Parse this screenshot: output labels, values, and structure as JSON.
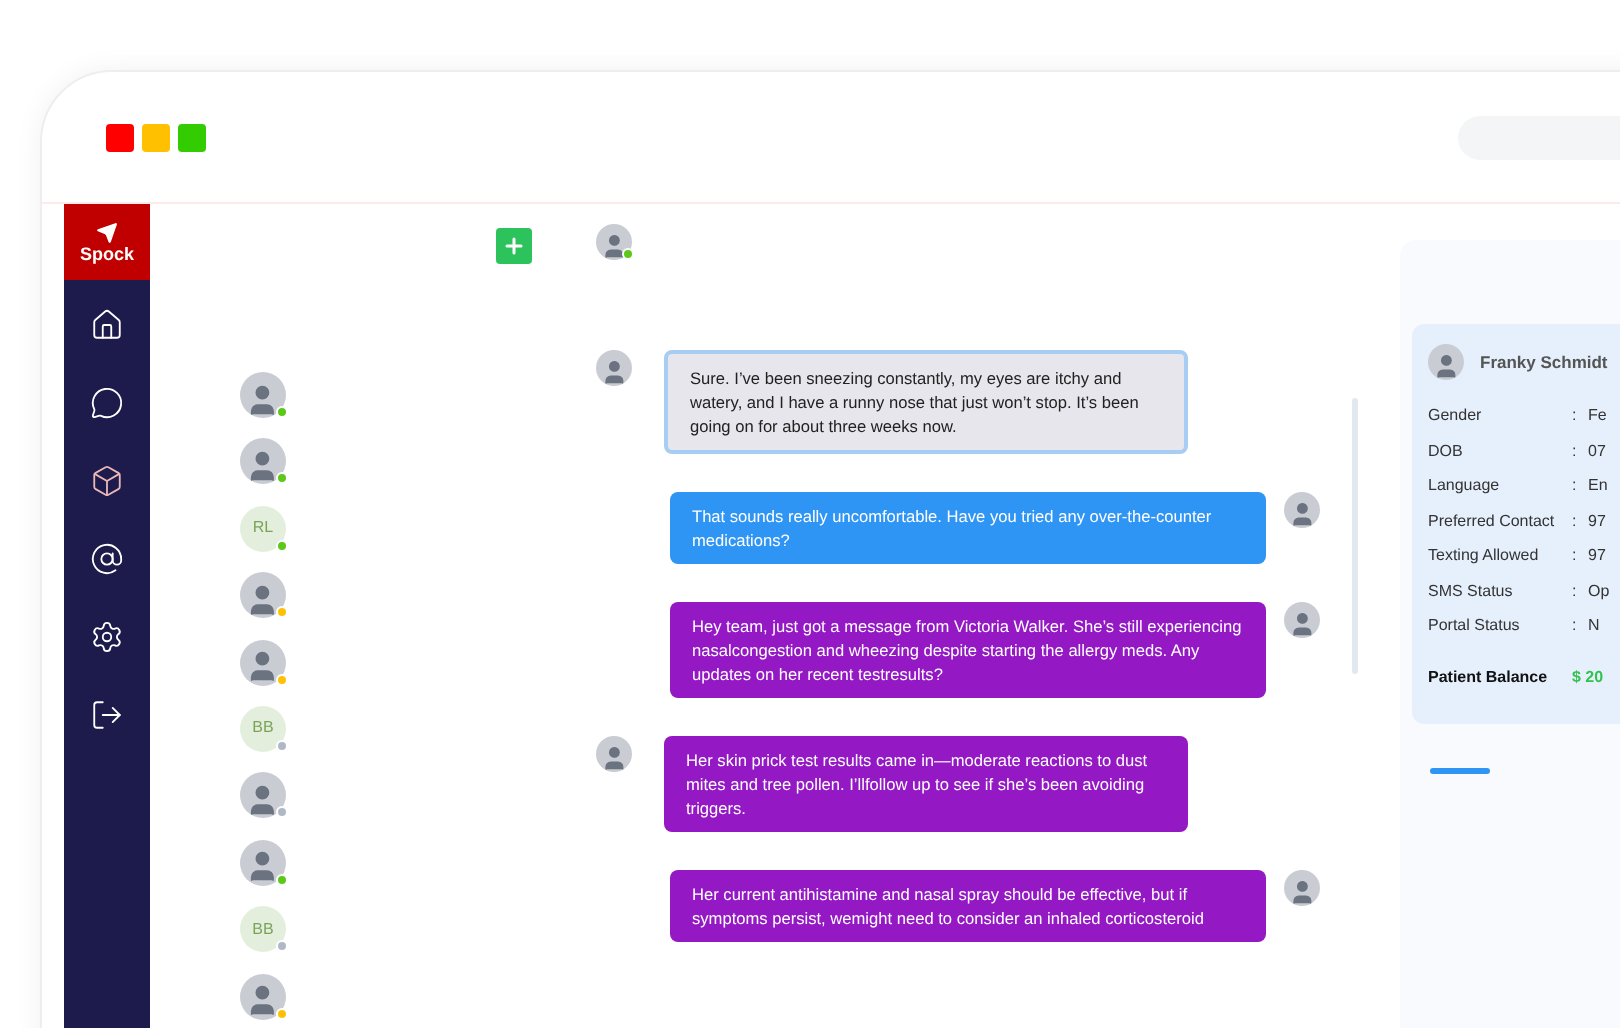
{
  "window": {
    "controls": [
      {
        "color": "#ff0000"
      },
      {
        "color": "#ffc000"
      },
      {
        "color": "#33cc00"
      }
    ]
  },
  "nav": {
    "logo": "Spock",
    "items": [
      {
        "kind": "home"
      },
      {
        "kind": "chat"
      },
      {
        "kind": "box"
      },
      {
        "kind": "at"
      },
      {
        "kind": "settings"
      },
      {
        "kind": "logout"
      }
    ]
  },
  "contacts": [
    {
      "kind": "photo",
      "color": "#5cc91a"
    },
    {
      "kind": "photo",
      "color": "#5cc91a"
    },
    {
      "kind": "initials",
      "initials": "RL",
      "color": "#5cc91a"
    },
    {
      "kind": "photo",
      "color": "#ffc107"
    },
    {
      "kind": "photo",
      "color": "#ffc107"
    },
    {
      "kind": "initials",
      "initials": "BB",
      "color": "#b0b8c8"
    },
    {
      "kind": "photo",
      "color": "#b0b8c8"
    },
    {
      "kind": "photo",
      "color": "#5cc91a"
    },
    {
      "kind": "initials",
      "initials": "BB",
      "color": "#b0b8c8"
    },
    {
      "kind": "photo",
      "color": "#ffc107"
    }
  ],
  "chat_header": {
    "color": "#5cc91a"
  },
  "messages": [
    {
      "kind": "incoming",
      "color": "#e6e6ec",
      "text": "Sure. I’ve been sneezing constantly, my eyes are itchy and watery, and I have a runny nose that just won’t stop. It’s been going on for about three weeks now."
    },
    {
      "kind": "outgoing",
      "color": "#2f95f5",
      "text": "That sounds really uncomfortable. Have you tried any over-the-counter medications?"
    },
    {
      "kind": "outgoing",
      "color": "#9419c4",
      "text": "Hey team, just got a message from Victoria Walker. She’s still experiencing nasalcongestion and wheezing despite starting  the allergy meds. Any updates on her recent testresults?"
    },
    {
      "kind": "incoming",
      "color": "#9419c4",
      "text": "Her skin prick test results came in—moderate reactions to dust mites and tree pollen. I’llfollow up to see if she’s been avoiding triggers."
    },
    {
      "kind": "outgoing",
      "color": "#9419c4",
      "text": "Her current antihistamine and nasal spray should be effective, but if symptoms persist, wemight need to consider an inhaled corticosteroid"
    }
  ],
  "patient": {
    "name": "Franky Schmidt",
    "fields": [
      {
        "label": "Gender",
        "separator": ":",
        "value": "Fe"
      },
      {
        "label": "DOB",
        "separator": ":",
        "value": "07"
      },
      {
        "label": "Language",
        "separator": ":",
        "value": "En"
      },
      {
        "label": "Preferred Contact",
        "separator": ":",
        "value": "97"
      },
      {
        "label": "Texting Allowed",
        "separator": ":",
        "value": "97"
      },
      {
        "label": "SMS Status",
        "separator": ":",
        "value": "Op"
      },
      {
        "label": "Portal Status",
        "separator": ":",
        "value": "N"
      }
    ],
    "balance_label": "Patient Balance",
    "balance_value": "$ 20"
  }
}
